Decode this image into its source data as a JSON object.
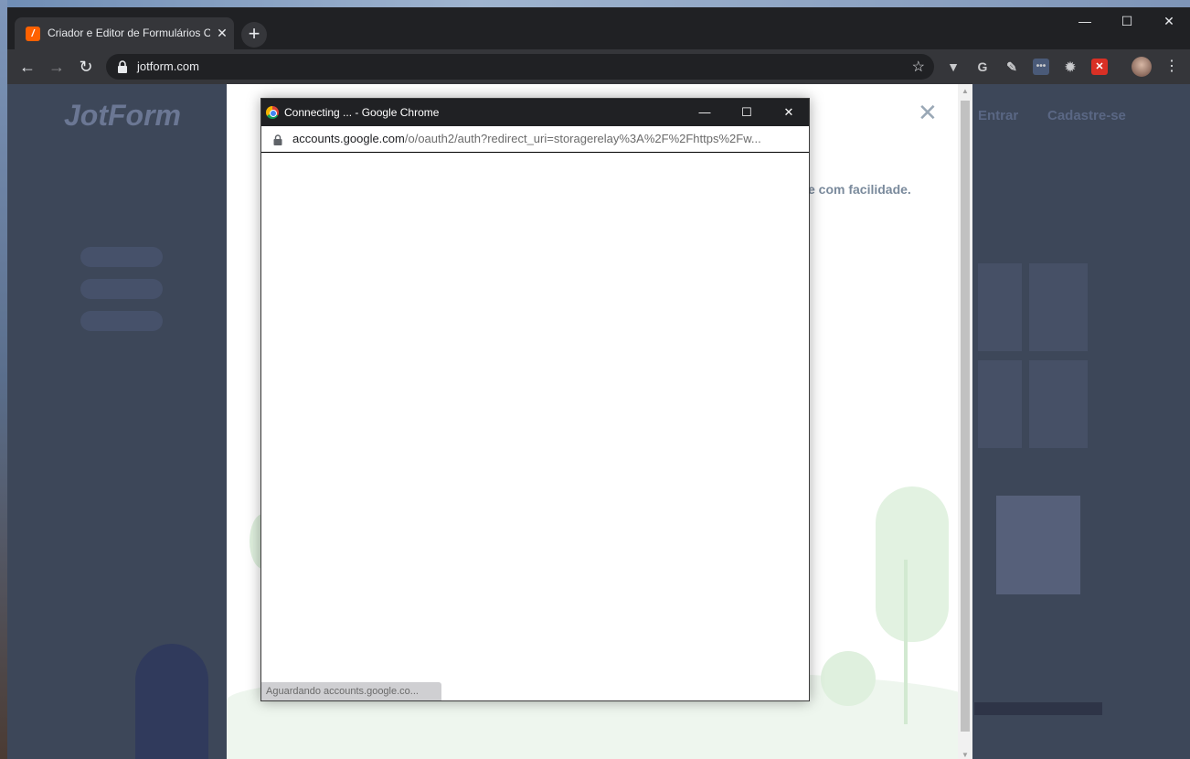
{
  "browser": {
    "tab_title": "Criador e Editor de Formulários Online",
    "tab_favicon": "jotform-logo",
    "url": "jotform.com",
    "window_controls": [
      "minimize-icon",
      "maximize-icon",
      "close-icon"
    ],
    "extensions": [
      "vivaldi-extension-icon",
      "grammarly-icon",
      "puzzle-extension-icon",
      "dots-extension-icon",
      "gear-extension-icon",
      "red-x-extension-icon"
    ]
  },
  "page": {
    "logo": "JotForm",
    "nav": {
      "login": "Entrar",
      "signup": "Cadastre-se"
    }
  },
  "modal": {
    "text_fragment": "e com facilidade."
  },
  "popup": {
    "title": "Connecting ... - Google Chrome",
    "url_host": "accounts.google.com",
    "url_path": "/o/oauth2/auth?redirect_uri=storagerelay%3A%2F%2Fhttps%2Fw...",
    "status": "Aguardando accounts.google.co..."
  },
  "colors": {
    "chrome_dark": "#202124",
    "chrome_toolbar": "#35363a",
    "overlay": "#3d4759",
    "jotform_orange": "#ff6100",
    "ground_green": "#eef6ee"
  }
}
